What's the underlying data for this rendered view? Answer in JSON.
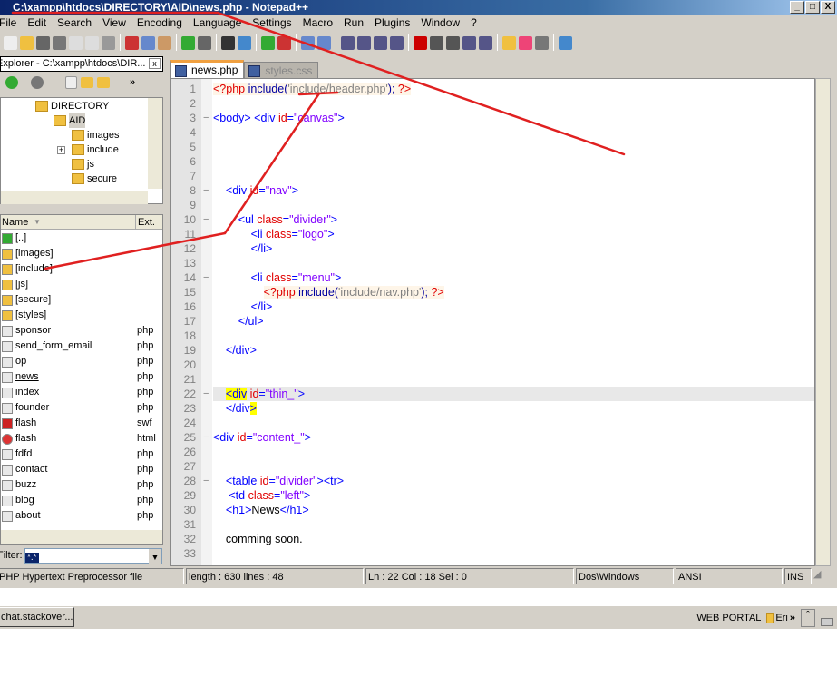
{
  "window": {
    "title": "C:\\xampp\\htdocs\\DIRECTORY\\AID\\news.php - Notepad++",
    "minimize": "_",
    "maximize": "□",
    "close": "X"
  },
  "menu": [
    "File",
    "Edit",
    "Search",
    "View",
    "Encoding",
    "Language",
    "Settings",
    "Macro",
    "Run",
    "Plugins",
    "Window",
    "?"
  ],
  "toolbar_icons": [
    "new-file",
    "open-file",
    "save",
    "save-all",
    "close",
    "close-all",
    "print",
    "cut",
    "copy",
    "paste",
    "undo",
    "redo",
    "find",
    "replace",
    "zoom-in",
    "zoom-out",
    "sync-vertical",
    "sync-horizontal",
    "word-wrap",
    "show-all-chars",
    "indent-guide",
    "user-defined-lang",
    "record-macro",
    "stop-macro",
    "play-macro",
    "run-macro-multiple",
    "save-macro",
    "explorer",
    "favorites",
    "spell-check",
    "abc-check"
  ],
  "explorer": {
    "title": "Explorer - C:\\xampp\\htdocs\\DIR...",
    "close": "x",
    "tree": [
      {
        "label": "DIRECTORY",
        "level": 0
      },
      {
        "label": "AID",
        "level": 1,
        "selected": true
      },
      {
        "label": "images",
        "level": 2
      },
      {
        "label": "include",
        "level": 2,
        "expandable": true
      },
      {
        "label": "js",
        "level": 2
      },
      {
        "label": "secure",
        "level": 2
      }
    ],
    "columns": {
      "name": "Name",
      "ext": "Ext."
    },
    "files": [
      {
        "name": "[..]",
        "ext": "",
        "icon": "up"
      },
      {
        "name": "[images]",
        "ext": "",
        "icon": "folder"
      },
      {
        "name": "[include]",
        "ext": "",
        "icon": "folder"
      },
      {
        "name": "[js]",
        "ext": "",
        "icon": "folder"
      },
      {
        "name": "[secure]",
        "ext": "",
        "icon": "folder"
      },
      {
        "name": "[styles]",
        "ext": "",
        "icon": "folder"
      },
      {
        "name": "sponsor",
        "ext": "php",
        "icon": "file"
      },
      {
        "name": "send_form_email",
        "ext": "php",
        "icon": "file"
      },
      {
        "name": "op",
        "ext": "php",
        "icon": "file"
      },
      {
        "name": "news",
        "ext": "php",
        "icon": "file",
        "underline": true
      },
      {
        "name": "index",
        "ext": "php",
        "icon": "file"
      },
      {
        "name": "founder",
        "ext": "php",
        "icon": "file"
      },
      {
        "name": "flash",
        "ext": "swf",
        "icon": "flash"
      },
      {
        "name": "flash",
        "ext": "html",
        "icon": "chrome"
      },
      {
        "name": "fdfd",
        "ext": "php",
        "icon": "file"
      },
      {
        "name": "contact",
        "ext": "php",
        "icon": "file"
      },
      {
        "name": "buzz",
        "ext": "php",
        "icon": "file"
      },
      {
        "name": "blog",
        "ext": "php",
        "icon": "file"
      },
      {
        "name": "about",
        "ext": "php",
        "icon": "file"
      }
    ],
    "filter_label": "Filter:",
    "filter_value": "*.*"
  },
  "tabs": [
    {
      "label": "news.php",
      "active": true
    },
    {
      "label": "styles.css",
      "active": false
    }
  ],
  "editor": {
    "current_line": 22,
    "lines": [
      {
        "n": "1",
        "fold": "",
        "tokens": [
          [
            "<?php ",
            "php"
          ],
          [
            "include(",
            "fn"
          ],
          [
            "'include/header.php'",
            "str"
          ],
          [
            "); ",
            "fn"
          ],
          [
            "?>",
            "php"
          ]
        ]
      },
      {
        "n": "2",
        "fold": "",
        "tokens": []
      },
      {
        "n": "3",
        "fold": "−",
        "tokens": [
          [
            "<body> <div ",
            "tag"
          ],
          [
            "id",
            "attr"
          ],
          [
            "=",
            "tag"
          ],
          [
            "\"canvas\"",
            "val"
          ],
          [
            ">",
            "tag"
          ]
        ]
      },
      {
        "n": "4",
        "fold": "",
        "tokens": []
      },
      {
        "n": "5",
        "fold": "",
        "tokens": []
      },
      {
        "n": "6",
        "fold": "",
        "tokens": []
      },
      {
        "n": "7",
        "fold": "",
        "tokens": []
      },
      {
        "n": "8",
        "fold": "−",
        "tokens": [
          [
            "    <div ",
            "tag"
          ],
          [
            "id",
            "attr"
          ],
          [
            "=",
            "tag"
          ],
          [
            "\"nav\"",
            "val"
          ],
          [
            ">",
            "tag"
          ]
        ]
      },
      {
        "n": "9",
        "fold": "",
        "tokens": []
      },
      {
        "n": "10",
        "fold": "−",
        "tokens": [
          [
            "        <ul ",
            "tag"
          ],
          [
            "class",
            "attr"
          ],
          [
            "=",
            "tag"
          ],
          [
            "\"divider\"",
            "val"
          ],
          [
            ">",
            "tag"
          ]
        ]
      },
      {
        "n": "11",
        "fold": "",
        "tokens": [
          [
            "            <li ",
            "tag"
          ],
          [
            "class",
            "attr"
          ],
          [
            "=",
            "tag"
          ],
          [
            "\"logo\"",
            "val"
          ],
          [
            ">",
            "tag"
          ]
        ]
      },
      {
        "n": "12",
        "fold": "",
        "tokens": [
          [
            "            </li>",
            "tag"
          ]
        ]
      },
      {
        "n": "13",
        "fold": "",
        "tokens": []
      },
      {
        "n": "14",
        "fold": "−",
        "tokens": [
          [
            "            <li ",
            "tag"
          ],
          [
            "class",
            "attr"
          ],
          [
            "=",
            "tag"
          ],
          [
            "\"menu\"",
            "val"
          ],
          [
            ">",
            "tag"
          ]
        ]
      },
      {
        "n": "15",
        "fold": "",
        "tokens": [
          [
            "                ",
            "txt"
          ],
          [
            "<?php ",
            "php"
          ],
          [
            "include(",
            "fn"
          ],
          [
            "'include/nav.php'",
            "str"
          ],
          [
            "); ",
            "fn"
          ],
          [
            "?>",
            "php"
          ]
        ]
      },
      {
        "n": "16",
        "fold": "",
        "tokens": [
          [
            "            </li>",
            "tag"
          ]
        ]
      },
      {
        "n": "17",
        "fold": "",
        "tokens": [
          [
            "        </ul>",
            "tag"
          ]
        ]
      },
      {
        "n": "18",
        "fold": "",
        "tokens": []
      },
      {
        "n": "19",
        "fold": "",
        "tokens": [
          [
            "    </div>",
            "tag"
          ]
        ]
      },
      {
        "n": "20",
        "fold": "",
        "tokens": []
      },
      {
        "n": "21",
        "fold": "",
        "tokens": []
      },
      {
        "n": "22",
        "fold": "−",
        "tokens": [
          [
            "    ",
            "txt"
          ],
          [
            "<div",
            "hl"
          ],
          [
            " id",
            "attr"
          ],
          [
            "=",
            "tag"
          ],
          [
            "\"thin_\"",
            "val"
          ],
          [
            ">",
            "tag"
          ]
        ]
      },
      {
        "n": "23",
        "fold": "",
        "tokens": [
          [
            "    ",
            "txt"
          ],
          [
            "</div",
            "tag"
          ],
          [
            ">",
            "hl"
          ]
        ]
      },
      {
        "n": "24",
        "fold": "",
        "tokens": []
      },
      {
        "n": "25",
        "fold": "−",
        "tokens": [
          [
            "<div ",
            "tag"
          ],
          [
            "id",
            "attr"
          ],
          [
            "=",
            "tag"
          ],
          [
            "\"content_\"",
            "val"
          ],
          [
            ">",
            "tag"
          ]
        ]
      },
      {
        "n": "26",
        "fold": "",
        "tokens": []
      },
      {
        "n": "27",
        "fold": "",
        "tokens": []
      },
      {
        "n": "28",
        "fold": "−",
        "tokens": [
          [
            "    <table ",
            "tag"
          ],
          [
            "id",
            "attr"
          ],
          [
            "=",
            "tag"
          ],
          [
            "\"divider\"",
            "val"
          ],
          [
            "><tr>",
            "tag"
          ]
        ]
      },
      {
        "n": "29",
        "fold": "",
        "tokens": [
          [
            "     <td ",
            "tag"
          ],
          [
            "class",
            "attr"
          ],
          [
            "=",
            "tag"
          ],
          [
            "\"left\"",
            "val"
          ],
          [
            ">",
            "tag"
          ]
        ]
      },
      {
        "n": "30",
        "fold": "",
        "tokens": [
          [
            "    <h1>",
            "tag"
          ],
          [
            "News",
            "txt"
          ],
          [
            "</h1>",
            "tag"
          ]
        ]
      },
      {
        "n": "31",
        "fold": "",
        "tokens": []
      },
      {
        "n": "32",
        "fold": "",
        "tokens": [
          [
            "    comming soon.",
            "txt"
          ]
        ]
      },
      {
        "n": "33",
        "fold": "",
        "tokens": []
      }
    ]
  },
  "status": {
    "filetype": "PHP Hypertext Preprocessor file",
    "length": "length : 630    lines : 48",
    "position": "Ln : 22    Col : 18    Sel : 0",
    "eol": "Dos\\Windows",
    "encoding": "ANSI",
    "mode": "INS"
  },
  "taskbar": {
    "button": "chat.stackover...",
    "tray_label": "WEB PORTAL",
    "tray_folder": "Eri",
    "more": "»",
    "arrow": "ˆ"
  },
  "annotation_color": "#e02020"
}
